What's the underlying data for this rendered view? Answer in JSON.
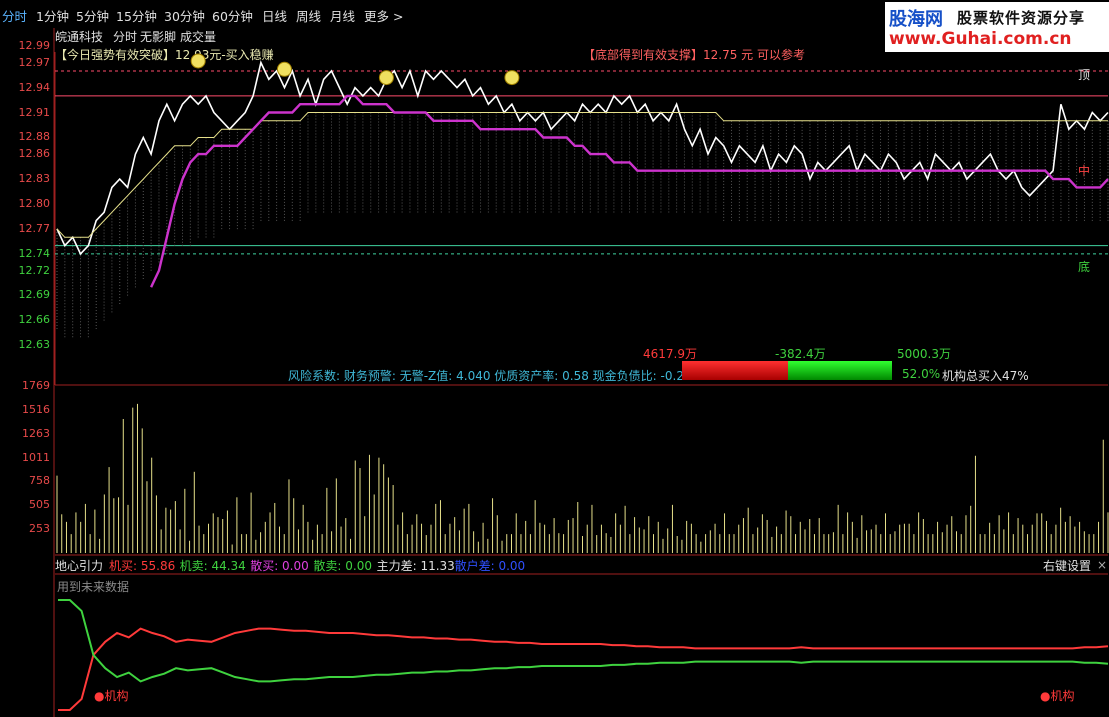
{
  "tabs": [
    "分时",
    "1分钟",
    "5分钟",
    "15分钟",
    "30分钟",
    "60分钟",
    "日线",
    "周线",
    "月线",
    "更多 >"
  ],
  "logo": {
    "part1": "股海网",
    "part2": "股票软件资源分享",
    "part3": "www.Guhai.com.cn"
  },
  "stock_name": "皖通科技",
  "sub_tabs": [
    "分时",
    "无影脚",
    "成交量"
  ],
  "signal_left": "【今日强势有效突破】12.93元-买入稳赚",
  "signal_right": "【底部得到有效支撑】12.75 元 可以参考",
  "label_top": "顶",
  "label_bottom": "底",
  "label_mid": "中",
  "risk_line": "风险系数: 财务预警: 无警-Z值: 4.040 优质资产率: 0.58 现金负债比: -0.22%",
  "bar_labels": {
    "left": "4617.9万",
    "mid": "-382.4万",
    "right": "5000.3万",
    "pct": "52.0%",
    "inst": "机构总买入47%"
  },
  "bottom_panel": {
    "title": "地心引力",
    "items": [
      {
        "label": "机买: 55.86",
        "color": "#ff3a3a"
      },
      {
        "label": "机卖: 44.34",
        "color": "#3fd23f"
      },
      {
        "label": "散买: 0.00",
        "color": "#e040e0"
      },
      {
        "label": "散卖: 0.00",
        "color": "#3fd23f"
      },
      {
        "label": "主力差: 11.33",
        "color": "#e0e0e0"
      },
      {
        "label": "散户差: 0.00",
        "color": "#3050ff"
      }
    ],
    "note": "用到未来数据",
    "settings": "右键设置",
    "close": "×",
    "mark_left": "机构",
    "mark_right": "机构"
  },
  "colors": {
    "price": "#ffffff",
    "avg": "#e6e08a",
    "purple": "#cc33cc",
    "buy": "#ff3a3a",
    "sell": "#3fd23f",
    "red_line": "#ff4d6d",
    "green_line": "#3fd2a0"
  },
  "chart_data": [
    {
      "type": "line",
      "title": "",
      "ylim": [
        12.61,
        12.99
      ],
      "y_ticks": [
        12.99,
        12.97,
        12.94,
        12.91,
        12.88,
        12.86,
        12.83,
        12.8,
        12.77,
        12.74,
        12.72,
        12.69,
        12.66,
        12.63
      ],
      "series": [
        {
          "name": "",
          "values": [
            12.77,
            12.75,
            12.76,
            12.74,
            12.75,
            12.78,
            12.79,
            12.82,
            12.83,
            12.82,
            12.86,
            12.88,
            12.86,
            12.9,
            12.92,
            12.9,
            12.92,
            12.93,
            12.92,
            12.93,
            12.91,
            12.9,
            12.89,
            12.9,
            12.91,
            12.93,
            12.97,
            12.95,
            12.96,
            12.94,
            12.96,
            12.93,
            12.95,
            12.92,
            12.95,
            12.96,
            12.94,
            12.92,
            12.94,
            12.93,
            12.94,
            12.93,
            12.95,
            12.96,
            12.94,
            12.96,
            12.93,
            12.96,
            12.95,
            12.96,
            12.95,
            12.94,
            12.95,
            12.93,
            12.94,
            12.92,
            12.93,
            12.91,
            12.92,
            12.9,
            12.91,
            12.9,
            12.91,
            12.89,
            12.9,
            12.91,
            12.9,
            12.92,
            12.91,
            12.92,
            12.91,
            12.93,
            12.92,
            12.93,
            12.91,
            12.92,
            12.9,
            12.91,
            12.9,
            12.92,
            12.89,
            12.87,
            12.89,
            12.86,
            12.88,
            12.87,
            12.85,
            12.87,
            12.86,
            12.85,
            12.87,
            12.84,
            12.86,
            12.85,
            12.87,
            12.86,
            12.83,
            12.85,
            12.84,
            12.85,
            12.86,
            12.87,
            12.84,
            12.86,
            12.85,
            12.84,
            12.86,
            12.85,
            12.83,
            12.84,
            12.85,
            12.83,
            12.86,
            12.85,
            12.84,
            12.85,
            12.83,
            12.84,
            12.85,
            12.86,
            12.84,
            12.83,
            12.84,
            12.82,
            12.81,
            12.82,
            12.83,
            12.84,
            12.92,
            12.89,
            12.9,
            12.89,
            12.91,
            12.9,
            12.91
          ]
        },
        {
          "name": "",
          "values": [
            12.77,
            12.76,
            12.76,
            12.76,
            12.76,
            12.77,
            12.78,
            12.79,
            12.8,
            12.81,
            12.82,
            12.83,
            12.84,
            12.85,
            12.86,
            12.87,
            12.87,
            12.87,
            12.88,
            12.88,
            12.88,
            12.89,
            12.89,
            12.89,
            12.89,
            12.89,
            12.9,
            12.9,
            12.9,
            12.9,
            12.9,
            12.9,
            12.91,
            12.91,
            12.91,
            12.91,
            12.91,
            12.91,
            12.91,
            12.91,
            12.91,
            12.91,
            12.91,
            12.91,
            12.91,
            12.91,
            12.91,
            12.91,
            12.91,
            12.91,
            12.91,
            12.91,
            12.91,
            12.91,
            12.91,
            12.91,
            12.91,
            12.91,
            12.91,
            12.91,
            12.91,
            12.91,
            12.91,
            12.91,
            12.91,
            12.91,
            12.91,
            12.91,
            12.91,
            12.91,
            12.91,
            12.91,
            12.91,
            12.91,
            12.91,
            12.91,
            12.91,
            12.91,
            12.91,
            12.91,
            12.91,
            12.91,
            12.91,
            12.91,
            12.91,
            12.9,
            12.9,
            12.9,
            12.9,
            12.9,
            12.9,
            12.9,
            12.9,
            12.9,
            12.9,
            12.9,
            12.9,
            12.9,
            12.9,
            12.9,
            12.9,
            12.9,
            12.9,
            12.9,
            12.9,
            12.9,
            12.9,
            12.9,
            12.9,
            12.9,
            12.9,
            12.9,
            12.9,
            12.9,
            12.9,
            12.9,
            12.9,
            12.9,
            12.9,
            12.9,
            12.9,
            12.9,
            12.9,
            12.9,
            12.9,
            12.9,
            12.9,
            12.9,
            12.9,
            12.9,
            12.9,
            12.9,
            12.9,
            12.9,
            12.9
          ]
        },
        {
          "name": "",
          "values": [
            null,
            null,
            null,
            null,
            null,
            null,
            null,
            null,
            null,
            null,
            null,
            null,
            12.7,
            12.72,
            12.76,
            12.8,
            12.83,
            12.85,
            12.86,
            12.86,
            12.87,
            12.87,
            12.87,
            12.87,
            12.88,
            12.89,
            12.9,
            12.91,
            12.91,
            12.91,
            12.91,
            12.92,
            12.92,
            12.92,
            12.92,
            12.92,
            12.92,
            12.93,
            12.93,
            12.92,
            12.92,
            12.92,
            12.92,
            12.91,
            12.91,
            12.91,
            12.91,
            12.91,
            12.9,
            12.9,
            12.9,
            12.9,
            12.9,
            12.9,
            12.89,
            12.89,
            12.89,
            12.89,
            12.89,
            12.89,
            12.89,
            12.89,
            12.88,
            12.88,
            12.88,
            12.88,
            12.87,
            12.87,
            12.86,
            12.86,
            12.86,
            12.85,
            12.85,
            12.85,
            12.84,
            12.84,
            12.84,
            12.84,
            12.84,
            12.84,
            12.84,
            12.84,
            12.84,
            12.84,
            12.84,
            12.84,
            12.84,
            12.84,
            12.84,
            12.84,
            12.84,
            12.84,
            12.84,
            12.84,
            12.84,
            12.84,
            12.84,
            12.84,
            12.84,
            12.84,
            12.84,
            12.84,
            12.84,
            12.84,
            12.84,
            12.84,
            12.84,
            12.84,
            12.84,
            12.84,
            12.84,
            12.84,
            12.84,
            12.84,
            12.84,
            12.84,
            12.84,
            12.84,
            12.84,
            12.84,
            12.84,
            12.84,
            12.84,
            12.84,
            12.84,
            12.84,
            12.84,
            12.83,
            12.83,
            12.83,
            12.82,
            12.82,
            12.82,
            12.82,
            12.83
          ]
        }
      ],
      "ref_lines": [
        {
          "value": 12.96,
          "color": "#ff4d6d",
          "dashed": true
        },
        {
          "value": 12.93,
          "color": "#ff4d6d",
          "dashed": false
        },
        {
          "value": 12.75,
          "color": "#3fd2a0",
          "dashed": false
        },
        {
          "value": 12.74,
          "color": "#3fd2a0",
          "dashed": true
        }
      ],
      "markers": [
        {
          "x_index": 18,
          "y": 12.96,
          "kind": "smile"
        },
        {
          "x_index": 29,
          "y": 12.95,
          "kind": "smile"
        },
        {
          "x_index": 42,
          "y": 12.94,
          "kind": "smile"
        },
        {
          "x_index": 58,
          "y": 12.94,
          "kind": "smile"
        }
      ],
      "grid": false
    },
    {
      "type": "bar",
      "title": "",
      "ylim": [
        0,
        1769
      ],
      "y_ticks": [
        1769,
        1516,
        1263,
        1011,
        758,
        505,
        253
      ],
      "values": [
        820,
        410,
        330,
        200,
        430,
        330,
        520,
        200,
        460,
        150,
        620,
        910,
        580,
        590,
        1420,
        510,
        1540,
        1580,
        1320,
        760,
        1010,
        610,
        250,
        480,
        460,
        550,
        250,
        680,
        130,
        860,
        290,
        200,
        310,
        420,
        380,
        360,
        450,
        90,
        590,
        200,
        200,
        640,
        140,
        220,
        330,
        430,
        530,
        280,
        200,
        780,
        580,
        250,
        510,
        330,
        140,
        300,
        200,
        690,
        230,
        790,
        280,
        370,
        150,
        980,
        900,
        390,
        1040,
        620,
        1010,
        940,
        800,
        720,
        300,
        430,
        200,
        300,
        410,
        310,
        190,
        300,
        520,
        560,
        200,
        310,
        380,
        240,
        470,
        520,
        230,
        120,
        320,
        150,
        580,
        400,
        130,
        200,
        200,
        420,
        200,
        340,
        200,
        560,
        320,
        300,
        200,
        370,
        210,
        200,
        350,
        370,
        540,
        180,
        300,
        510,
        190,
        300,
        210,
        170,
        420,
        300,
        500,
        200,
        380,
        270,
        250,
        390,
        200,
        330,
        150,
        260,
        510,
        180,
        140,
        340,
        310,
        200,
        120,
        200,
        240,
        310,
        200,
        420,
        200,
        200,
        300,
        370,
        480,
        200,
        270,
        410,
        350,
        170,
        280,
        200,
        450,
        390,
        200,
        330,
        250,
        360,
        200,
        370,
        200,
        200,
        220,
        510,
        200,
        430,
        330,
        160,
        400,
        240,
        250,
        300,
        200,
        420,
        200,
        230,
        300,
        310,
        310,
        200,
        430,
        360,
        200,
        200,
        330,
        220,
        300,
        390,
        230,
        200,
        400,
        500,
        1030,
        200,
        200,
        320,
        200,
        400,
        250,
        430,
        200,
        370,
        300,
        200,
        300,
        420,
        420,
        340,
        200,
        300,
        480,
        330,
        390,
        280,
        330,
        230,
        200,
        200,
        330,
        1200,
        430
      ]
    },
    {
      "type": "line",
      "title": "",
      "ylim": [
        0,
        100
      ],
      "series": [
        {
          "name": "机买",
          "values": [
            0,
            0,
            10,
            50,
            62,
            70,
            66,
            74,
            70,
            67,
            62,
            64,
            63,
            62,
            66,
            70,
            72,
            74,
            74,
            73,
            72,
            72,
            71,
            70,
            70,
            70,
            69,
            68,
            68,
            67,
            66,
            66,
            65,
            65,
            64,
            64,
            63,
            62,
            62,
            61,
            61,
            60,
            60,
            60,
            60,
            60,
            60,
            59,
            59,
            58,
            58,
            57,
            57,
            57,
            56,
            56,
            56,
            56,
            56,
            56,
            56,
            56,
            56,
            57,
            56,
            56,
            56,
            56,
            56,
            56,
            56,
            56,
            56,
            56,
            56,
            56,
            56,
            56,
            56,
            56,
            56,
            56,
            56,
            56,
            56,
            56,
            56,
            57,
            57,
            58
          ]
        },
        {
          "name": "机卖",
          "values": [
            100,
            100,
            90,
            50,
            38,
            30,
            34,
            26,
            30,
            33,
            38,
            36,
            37,
            38,
            34,
            30,
            28,
            26,
            26,
            27,
            28,
            28,
            29,
            30,
            30,
            30,
            31,
            32,
            32,
            33,
            34,
            34,
            35,
            35,
            36,
            36,
            37,
            38,
            38,
            39,
            39,
            40,
            40,
            40,
            40,
            40,
            40,
            41,
            41,
            42,
            42,
            43,
            43,
            43,
            44,
            44,
            44,
            44,
            44,
            44,
            44,
            44,
            44,
            43,
            44,
            44,
            44,
            44,
            44,
            44,
            44,
            44,
            44,
            44,
            44,
            44,
            44,
            44,
            44,
            44,
            44,
            44,
            44,
            44,
            44,
            44,
            44,
            43,
            43,
            42
          ]
        }
      ]
    }
  ]
}
